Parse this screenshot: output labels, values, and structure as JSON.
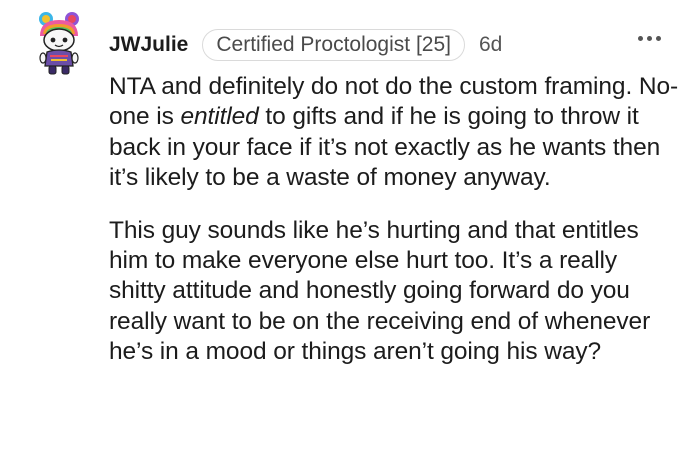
{
  "comment": {
    "username": "JWJulie",
    "flair": "Certified Proctologist [25]",
    "age": "6d",
    "paragraphs": {
      "p1": {
        "before": "NTA and definitely do not do the custom framing. No-one is ",
        "emphasis": "entitled",
        "after": " to gifts and if he is going to throw it back in your face if it’s not exactly as he wants then it’s likely to be a waste of money anyway."
      },
      "p2": "This guy sounds like he’s hurting and that entitles him to make everyone else hurt too. It’s a really shitty attitude and honestly going forward do you really want to be on the receiving end of whenever he’s in a mood or things aren’t going his way?"
    },
    "avatar_icon": "snoo-avatar-icon",
    "more_icon": "more-options-icon"
  }
}
